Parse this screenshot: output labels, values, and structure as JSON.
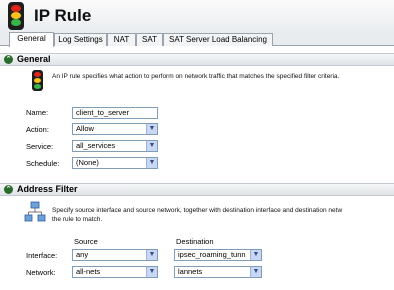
{
  "header": {
    "title": "IP Rule"
  },
  "tabs": [
    {
      "label": "General"
    },
    {
      "label": "Log Settings"
    },
    {
      "label": "NAT"
    },
    {
      "label": "SAT"
    },
    {
      "label": "SAT Server Load Balancing"
    }
  ],
  "general": {
    "title": "General",
    "description": "An IP rule specifies what action to perform on network traffic that matches the specified filter criteria.",
    "name_label": "Name:",
    "name_value": "client_to_server",
    "action_label": "Action:",
    "action_value": "Allow",
    "service_label": "Service:",
    "service_value": "all_services",
    "schedule_label": "Schedule:",
    "schedule_value": "(None)"
  },
  "address_filter": {
    "title": "Address Filter",
    "description_line1": "Specify source interface and source network, together with destination interface and destination netw",
    "description_line2": "the rule to match.",
    "source_header": "Source",
    "destination_header": "Destination",
    "interface_label": "Interface:",
    "network_label": "Network:",
    "source_interface": "any",
    "source_network": "all-nets",
    "dest_interface": "ipsec_roaming_tunn",
    "dest_network": "lannets"
  },
  "icons": {
    "traffic_light": "traffic-light-icon",
    "section_collapse": "chevron-up-icon",
    "network": "network-icon",
    "dropdown": "dropdown-arrow-icon"
  }
}
